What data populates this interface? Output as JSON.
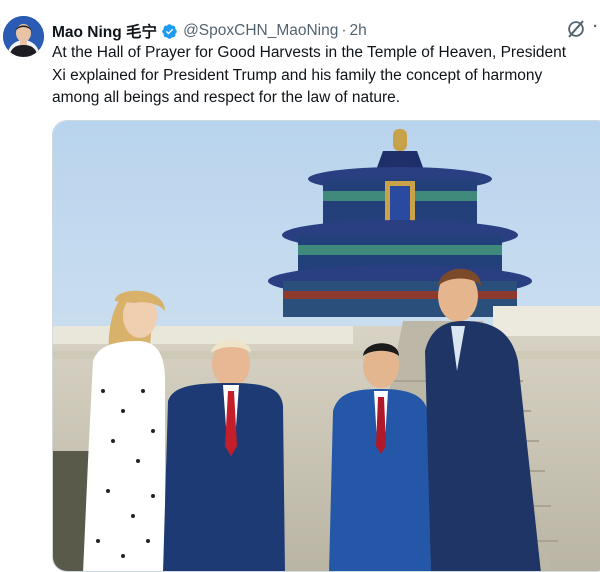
{
  "author": {
    "display_name": "Mao Ning 毛宁",
    "handle": "@SpoxCHN_MaoNing",
    "separator": "·",
    "timestamp": "2h",
    "verified_badge_icon": "verified-badge-icon",
    "avatar_icon": "avatar"
  },
  "tweet": {
    "lines": [
      "At the Hall of Prayer for Good Harvests in the Temple of Heaven, President",
      "Xi explained for President Trump and his family the concept of harmony",
      "among all beings and respect for the law of nature."
    ]
  },
  "actions": {
    "grok_icon": "grok-icon",
    "more_icon": "more-options-icon",
    "more_label": "·"
  },
  "media": {
    "type": "photo",
    "icon": "photo-image"
  },
  "colors": {
    "text": "#0f1419",
    "secondary": "#536471",
    "verified": "#1d9bf0",
    "border": "#cfd9de"
  }
}
